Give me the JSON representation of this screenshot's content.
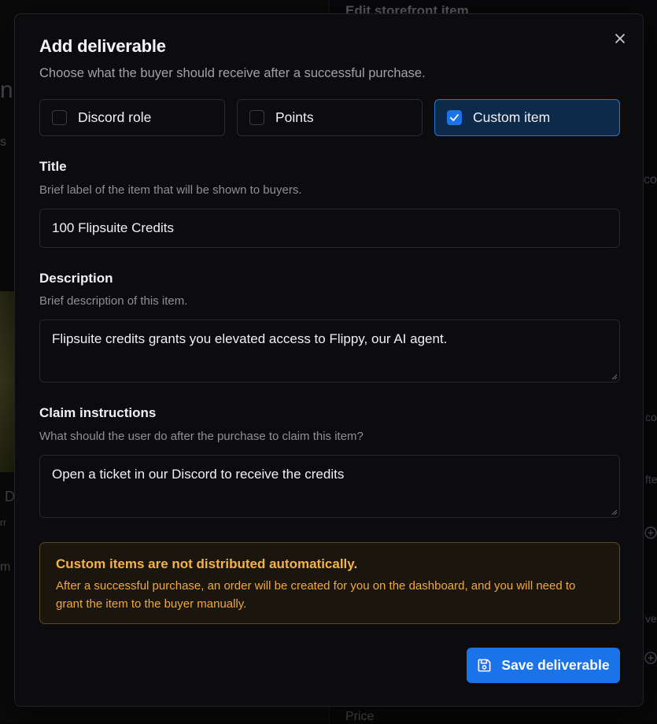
{
  "background": {
    "title": "Edit storefront item",
    "price_label": "Price",
    "fragments": [
      "n",
      "s",
      "co",
      "D",
      "co",
      "fte",
      "ver",
      "rr",
      "m"
    ]
  },
  "modal": {
    "title": "Add deliverable",
    "subtitle": "Choose what the buyer should receive after a successful purchase.",
    "close_icon": "close-icon",
    "deliverable_types": [
      {
        "label": "Discord role",
        "checked": false
      },
      {
        "label": "Points",
        "checked": false
      },
      {
        "label": "Custom item",
        "checked": true
      }
    ],
    "fields": {
      "title": {
        "label": "Title",
        "help": "Brief label of the item that will be shown to buyers.",
        "value": "100 Flipsuite Credits"
      },
      "description": {
        "label": "Description",
        "help": "Brief description of this item.",
        "value": "Flipsuite credits grants you elevated access to Flippy, our AI agent."
      },
      "claim_instructions": {
        "label": "Claim instructions",
        "help": "What should the user do after the purchase to claim this item?",
        "value": "Open a ticket in our Discord to receive the credits"
      }
    },
    "warning": {
      "title": "Custom items are not distributed automatically.",
      "body": "After a successful purchase, an order will be created for you on the dashboard, and you will need to grant the item to the buyer manually."
    },
    "save_button": {
      "label": "Save deliverable",
      "icon": "save-icon"
    }
  },
  "colors": {
    "accent": "#1a73e8",
    "warning_text": "#f5b347",
    "modal_bg": "#0c0c0e"
  }
}
